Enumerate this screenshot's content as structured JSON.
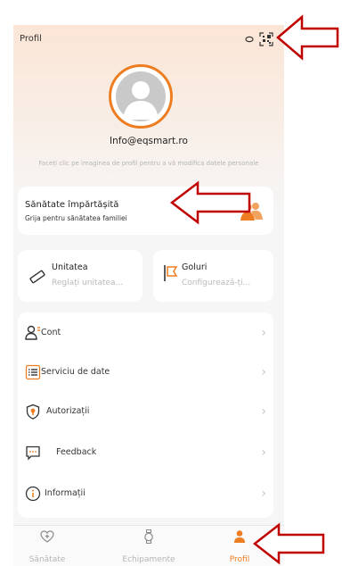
{
  "header": {
    "title": "Profil"
  },
  "profile": {
    "email": "Info@eqsmart.ro",
    "hint": "Faceți clic pe imaginea de profil pentru a vă modifica datele personale"
  },
  "shared_health": {
    "title": "Sănătate împărtășită",
    "subtitle": "Grija pentru sănătatea familiei"
  },
  "tiles": {
    "unit": {
      "label": "Unitatea",
      "sub": "Reglați unitatea..."
    },
    "goals": {
      "label": "Goluri",
      "sub": "Configurează-ți..."
    }
  },
  "menu": [
    {
      "label": "Cont",
      "icon": "user-icon"
    },
    {
      "label": "Serviciu de date",
      "icon": "list-icon"
    },
    {
      "label": "Autorizații",
      "icon": "shield-icon"
    },
    {
      "label": "Feedback",
      "icon": "chat-icon"
    },
    {
      "label": "Informații",
      "icon": "info-icon"
    }
  ],
  "tabs": [
    {
      "label": "Sănătate",
      "icon": "heart-plus-icon"
    },
    {
      "label": "Echipamente",
      "icon": "watch-icon"
    },
    {
      "label": "Profil",
      "icon": "person-icon",
      "active": true
    }
  ],
  "colors": {
    "accent": "#ee7d22",
    "annotation": "#c00000"
  }
}
